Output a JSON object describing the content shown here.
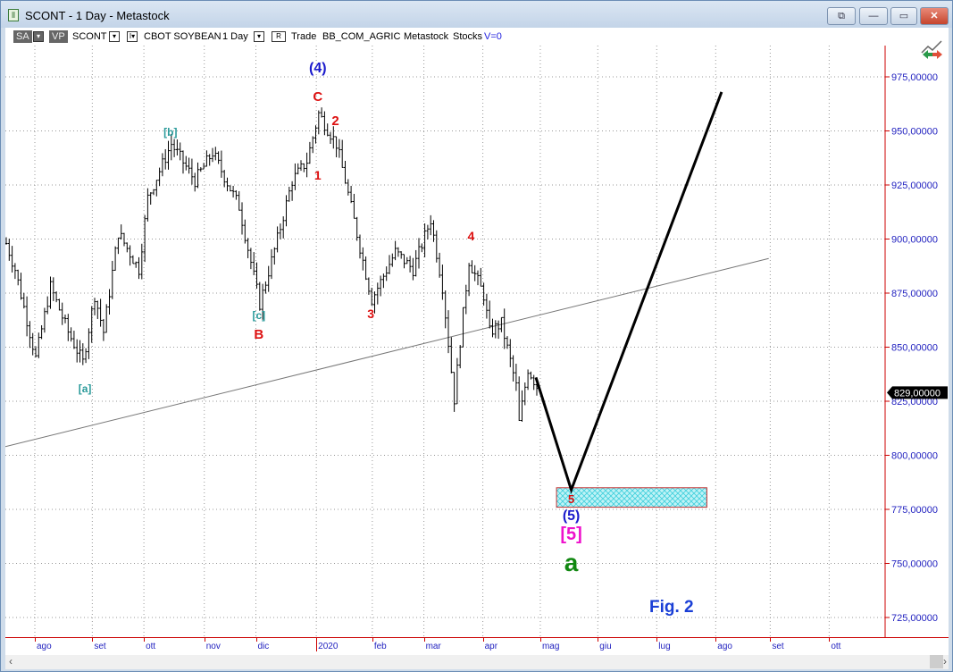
{
  "window": {
    "title": "SCONT - 1 Day - Metastock",
    "buttons": {
      "restore_label": "⧉",
      "minimize_label": "—",
      "maximize_label": "▭",
      "close_label": "✕"
    }
  },
  "toolbar": {
    "sa": "SA",
    "vp": "VP",
    "symbol": "SCONT",
    "name": "CBOT SOYBEAN",
    "period": "1 Day",
    "r": "R",
    "trade": "Trade",
    "source": "BB_COM_AGRIC",
    "vendor": "Metastock",
    "type": "Stocks",
    "volume": "V=0"
  },
  "colors": {
    "axis": "#cc0000",
    "price_text": "#1f1fbf",
    "bars": "#000000",
    "zone_fill": "#7fe3ea",
    "zone_border": "#c03030"
  },
  "chart_data": {
    "type": "bar",
    "ylim": [
      715,
      990
    ],
    "price_ticks": [
      "975,00000",
      "950,00000",
      "925,00000",
      "900,00000",
      "875,00000",
      "850,00000",
      "825,00000",
      "800,00000",
      "775,00000",
      "750,00000",
      "725,00000"
    ],
    "price_tick_values": [
      975,
      950,
      925,
      900,
      875,
      850,
      825,
      800,
      775,
      750,
      725
    ],
    "month_ticks": [
      "ago",
      "set",
      "ott",
      "nov",
      "dic",
      "2020",
      "feb",
      "mar",
      "apr",
      "mag",
      "giu",
      "lug",
      "ago",
      "set",
      "ott"
    ],
    "month_tick_days": [
      10,
      29.5,
      47,
      67.5,
      85,
      105.5,
      124.5,
      142,
      162,
      181.5,
      201,
      221,
      241,
      259.5,
      279.5
    ],
    "last_price": "829,00000",
    "last_price_value": 829,
    "price_path": [
      [
        0,
        898
      ],
      [
        3,
        886
      ],
      [
        10,
        845
      ],
      [
        15,
        878
      ],
      [
        21,
        857
      ],
      [
        26,
        843
      ],
      [
        30,
        874
      ],
      [
        33,
        857
      ],
      [
        38,
        903
      ],
      [
        45,
        886
      ],
      [
        48,
        919
      ],
      [
        56,
        944
      ],
      [
        64,
        927
      ],
      [
        70,
        940
      ],
      [
        79,
        915
      ],
      [
        86,
        870
      ],
      [
        92,
        900
      ],
      [
        97,
        927
      ],
      [
        102,
        936
      ],
      [
        106,
        958
      ],
      [
        112,
        944
      ],
      [
        115,
        927
      ],
      [
        121,
        890
      ],
      [
        124,
        872
      ],
      [
        132,
        894
      ],
      [
        138,
        886
      ],
      [
        144,
        909
      ],
      [
        148,
        878
      ],
      [
        152,
        826
      ],
      [
        154,
        853
      ],
      [
        157,
        890
      ],
      [
        162,
        874
      ],
      [
        164,
        857
      ],
      [
        168,
        861
      ],
      [
        173,
        832
      ],
      [
        174,
        815
      ],
      [
        177,
        840
      ],
      [
        180,
        832
      ]
    ],
    "projection": [
      [
        180,
        836
      ],
      [
        192,
        784
      ],
      [
        243,
        968
      ]
    ],
    "trendline": [
      [
        0,
        804
      ],
      [
        259,
        891
      ]
    ],
    "target_zone": {
      "day_from": 187,
      "day_to": 238,
      "price_low": 776,
      "price_high": 785
    },
    "wave_labels": [
      {
        "text": "(4)",
        "day": 106,
        "price": 979,
        "color": "#1a1acc",
        "size": 16
      },
      {
        "text": "C",
        "day": 106,
        "price": 966,
        "color": "#dd1111",
        "size": 15
      },
      {
        "text": "2",
        "day": 112,
        "price": 955,
        "color": "#dd1111",
        "size": 15
      },
      {
        "text": "1",
        "day": 106,
        "price": 930,
        "color": "#dd1111",
        "size": 14
      },
      {
        "text": "[b]",
        "day": 56,
        "price": 950,
        "color": "#2a9a9a",
        "size": 12
      },
      {
        "text": "[c]",
        "day": 86,
        "price": 865,
        "color": "#2a9a9a",
        "size": 12
      },
      {
        "text": "B",
        "day": 86,
        "price": 856,
        "color": "#dd1111",
        "size": 15
      },
      {
        "text": "3",
        "day": 124,
        "price": 866,
        "color": "#dd1111",
        "size": 14
      },
      {
        "text": "4",
        "day": 158,
        "price": 902,
        "color": "#dd1111",
        "size": 14
      },
      {
        "text": "[a]",
        "day": 27,
        "price": 831,
        "color": "#2a9a9a",
        "size": 12
      },
      {
        "text": "5",
        "day": 192,
        "price": 780,
        "color": "#dd1111",
        "size": 13
      },
      {
        "text": "(5)",
        "day": 192,
        "price": 772,
        "color": "#1a1acc",
        "size": 16
      },
      {
        "text": "[5]",
        "day": 192,
        "price": 764,
        "color": "#ee11cc",
        "size": 20
      },
      {
        "text": "a",
        "day": 192,
        "price": 751,
        "color": "#118811",
        "size": 28
      },
      {
        "text": "Fig. 2",
        "day": 226,
        "price": 730,
        "color": "#1a3fd6",
        "size": 19
      }
    ]
  },
  "scrollbar": {
    "left": "‹",
    "right": "›"
  }
}
